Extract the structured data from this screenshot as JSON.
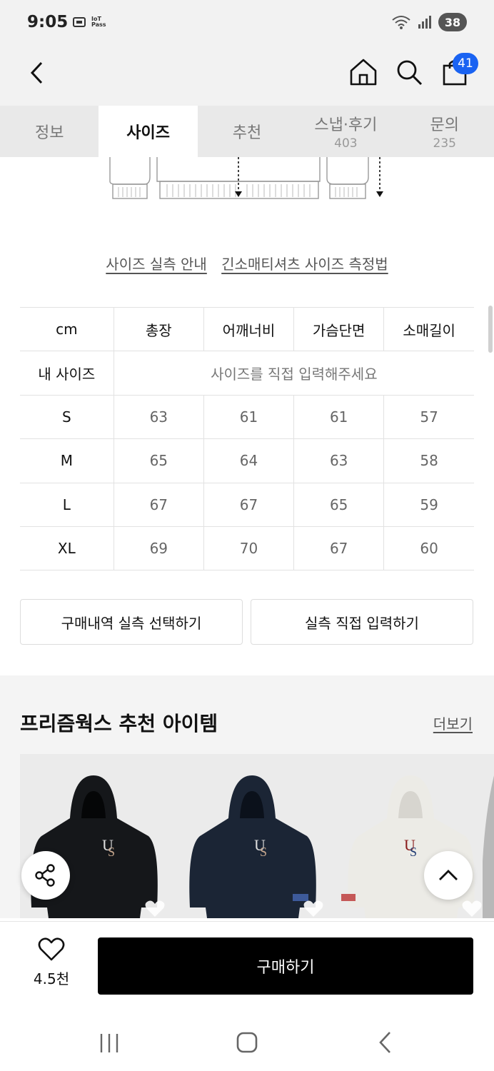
{
  "status_bar": {
    "time": "9:05",
    "iot_line1": "IoT",
    "iot_line2": "Pass",
    "battery": "38"
  },
  "header": {
    "cart_count": "41"
  },
  "tabs": [
    {
      "label": "정보",
      "count": ""
    },
    {
      "label": "사이즈",
      "count": ""
    },
    {
      "label": "추천",
      "count": ""
    },
    {
      "label": "스냅·후기",
      "count": "403"
    },
    {
      "label": "문의",
      "count": "235"
    }
  ],
  "size_links": {
    "guide": "사이즈 실측 안내",
    "method": "긴소매티셔츠 사이즈 측정법"
  },
  "size_table": {
    "headers": [
      "cm",
      "총장",
      "어깨너비",
      "가슴단면",
      "소매길이"
    ],
    "my_size_label": "내 사이즈",
    "my_size_placeholder": "사이즈를 직접 입력해주세요",
    "rows": [
      {
        "size": "S",
        "values": [
          "63",
          "61",
          "61",
          "57"
        ]
      },
      {
        "size": "M",
        "values": [
          "65",
          "64",
          "63",
          "58"
        ]
      },
      {
        "size": "L",
        "values": [
          "67",
          "67",
          "65",
          "59"
        ]
      },
      {
        "size": "XL",
        "values": [
          "69",
          "70",
          "67",
          "60"
        ]
      }
    ]
  },
  "buttons": {
    "purchase_history": "구매내역 실측 선택하기",
    "direct_input": "실측 직접 입력하기"
  },
  "recommend": {
    "title": "프리즘웍스 추천 아이템",
    "more": "더보기"
  },
  "products": [
    {
      "color": "#15171a"
    },
    {
      "color": "#1b2535"
    },
    {
      "color": "#ecebe6"
    }
  ],
  "bottom": {
    "like_count": "4.5천",
    "buy_label": "구매하기"
  },
  "colors": {
    "accent": "#1a63f2",
    "buy": "#000000",
    "tab_bg": "#e9e9e9"
  }
}
